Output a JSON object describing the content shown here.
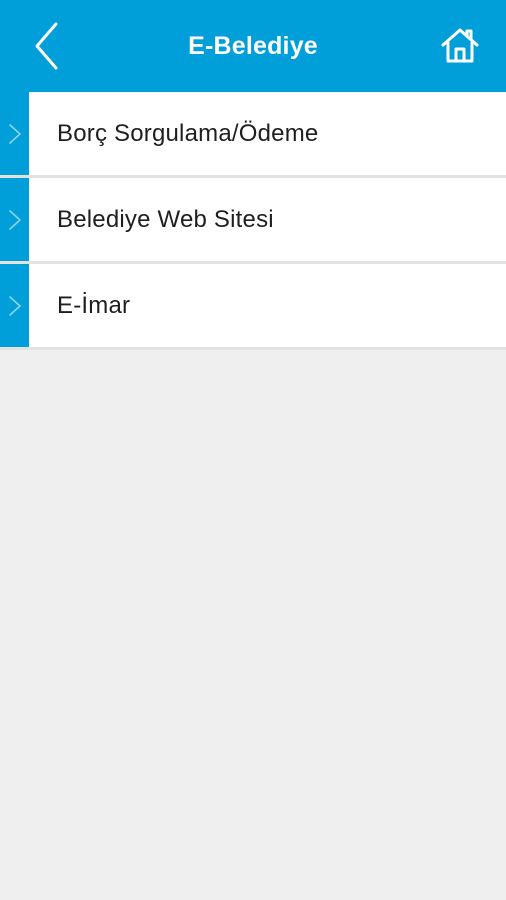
{
  "header": {
    "title": "E-Belediye",
    "back_icon": "chevron-left-icon",
    "home_icon": "home-icon"
  },
  "menu": {
    "items": [
      {
        "label": "Borç Sorgulama/Ödeme",
        "icon": "chevron-right-icon"
      },
      {
        "label": "Belediye Web Sitesi",
        "icon": "chevron-right-icon"
      },
      {
        "label": "E-İmar",
        "icon": "chevron-right-icon"
      }
    ]
  },
  "colors": {
    "primary": "#009fd9",
    "background": "#efefef",
    "item_background": "#ffffff",
    "text": "#1f1f1f",
    "divider": "#e2e2e2"
  }
}
